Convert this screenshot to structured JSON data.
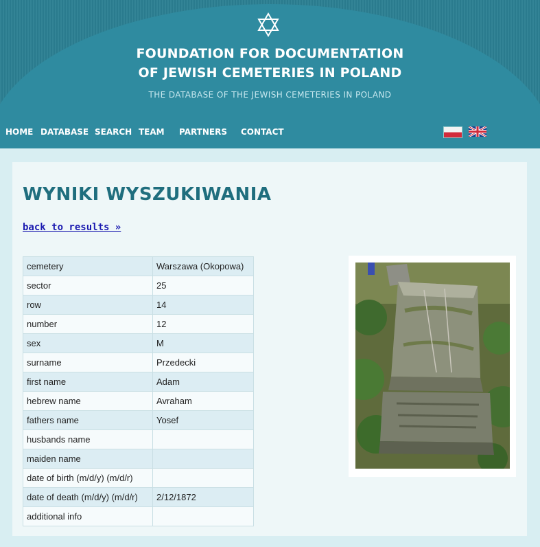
{
  "header": {
    "title_line1": "FOUNDATION FOR DOCUMENTATION",
    "title_line2": "OF JEWISH CEMETERIES IN POLAND",
    "subtitle": "THE DATABASE OF THE JEWISH CEMETERIES IN POLAND",
    "logo_icon": "star-of-david-icon"
  },
  "nav": {
    "items": [
      {
        "label": "HOME"
      },
      {
        "label": "DATABASE"
      },
      {
        "label": "SEARCH"
      },
      {
        "label": "TEAM"
      },
      {
        "label": "PARTNERS"
      },
      {
        "label": "CONTACT"
      }
    ],
    "languages": [
      "polish-flag-icon",
      "uk-flag-icon"
    ]
  },
  "page": {
    "title": "WYNIKI WYSZUKIWANIA",
    "back_link": "back to results »"
  },
  "record": {
    "rows": [
      {
        "label": "cemetery",
        "value": "Warszawa (Okopowa)"
      },
      {
        "label": "sector",
        "value": "25"
      },
      {
        "label": "row",
        "value": "14"
      },
      {
        "label": "number",
        "value": "12"
      },
      {
        "label": "sex",
        "value": "M"
      },
      {
        "label": "surname",
        "value": "Przedecki"
      },
      {
        "label": "first name",
        "value": "Adam"
      },
      {
        "label": "hebrew name",
        "value": "Avraham"
      },
      {
        "label": "fathers name",
        "value": "Yosef"
      },
      {
        "label": "husbands name",
        "value": ""
      },
      {
        "label": "maiden name",
        "value": ""
      },
      {
        "label": "date of birth (m/d/y) (m/d/r)",
        "value": ""
      },
      {
        "label": "date of death (m/d/y) (m/d/r)",
        "value": "2/12/1872"
      },
      {
        "label": "additional info",
        "value": ""
      }
    ]
  },
  "colors": {
    "header_bg": "#2b7f92",
    "arc": "#2f8ba0",
    "title_teal": "#1f6e7e",
    "link_blue": "#1a1ab0",
    "row_odd": "#dcedf3",
    "row_even": "#f6fbfc"
  }
}
